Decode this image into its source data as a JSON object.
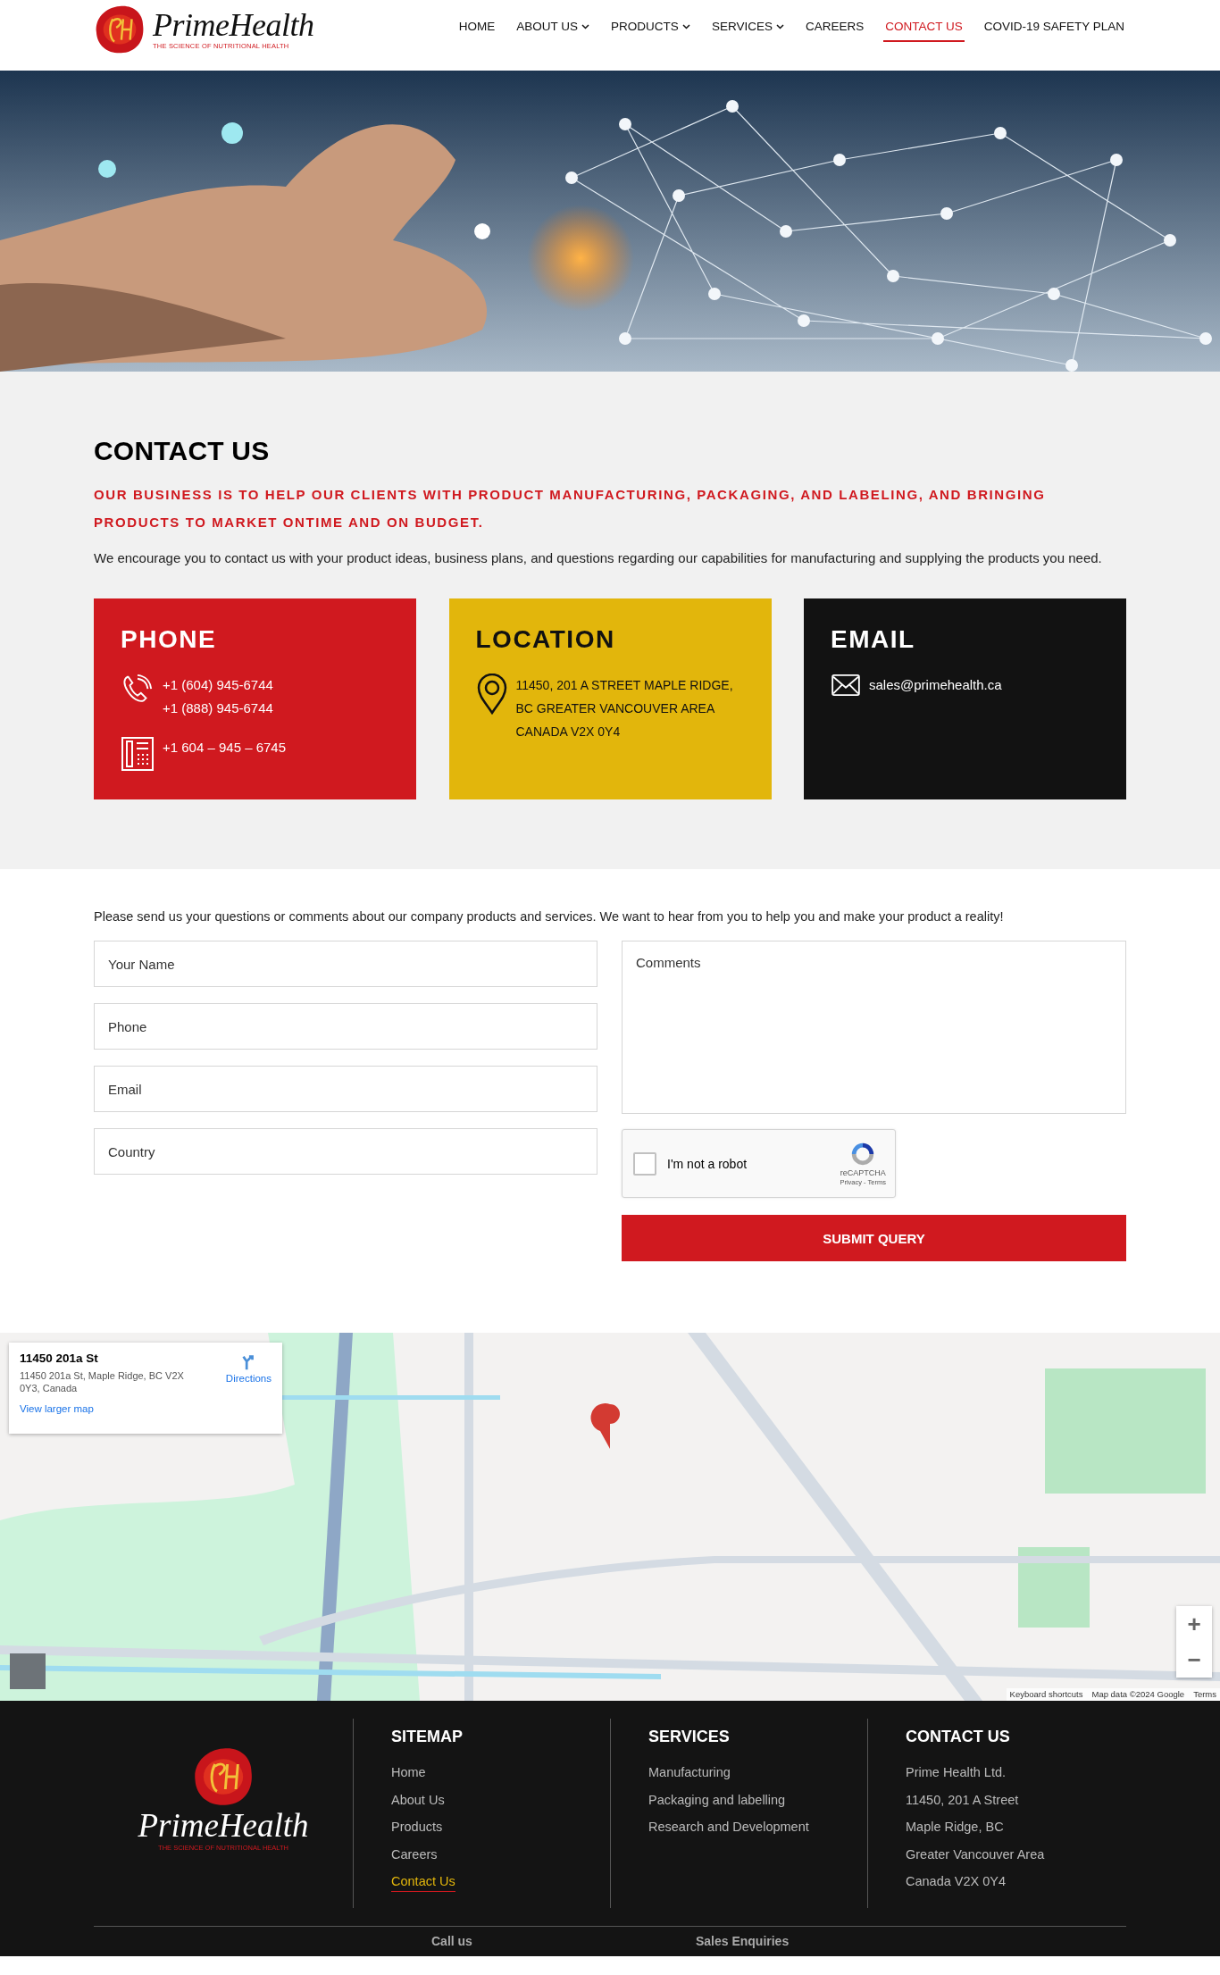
{
  "header": {
    "logo": {
      "name": "PrimeHealth",
      "tagline": "THE SCIENCE OF NUTRITIONAL HEALTH"
    },
    "nav": [
      {
        "label": "HOME",
        "dropdown": false,
        "selected": false
      },
      {
        "label": "ABOUT US",
        "dropdown": true,
        "selected": false
      },
      {
        "label": "PRODUCTS",
        "dropdown": true,
        "selected": false
      },
      {
        "label": "SERVICES",
        "dropdown": true,
        "selected": false
      },
      {
        "label": "CAREERS",
        "dropdown": false,
        "selected": false
      },
      {
        "label": "CONTACT US",
        "dropdown": false,
        "selected": true
      },
      {
        "label": "COVID-19 SAFETY PLAN",
        "dropdown": false,
        "selected": false
      }
    ]
  },
  "contact": {
    "title": "CONTACT US",
    "tagline": "OUR BUSINESS IS TO HELP OUR CLIENTS WITH PRODUCT MANUFACTURING, PACKAGING, AND LABELING, AND BRINGING PRODUCTS TO MARKET ONTIME AND ON BUDGET.",
    "intro": "We encourage you to contact us with your product ideas, business plans, and questions regarding our capabilities for manufacturing and supplying the products you need.",
    "cards": [
      {
        "kind": "phone",
        "title": "PHONE",
        "color": "#d0191f",
        "groups": [
          {
            "kind": "phone",
            "lines": [
              "+1 (604) 945-6744",
              "+1 (888) 945-6744"
            ]
          },
          {
            "kind": "fax",
            "lines": [
              "+1 604 – 945 – 6745"
            ]
          }
        ]
      },
      {
        "kind": "location",
        "title": "LOCATION",
        "color": "#e2b60c",
        "groups": [
          {
            "kind": "pin",
            "lines": [
              "11450, 201 A STREET MAPLE RIDGE,",
              "BC GREATER VANCOUVER AREA",
              "CANADA V2X 0Y4"
            ]
          }
        ]
      },
      {
        "kind": "email",
        "title": "EMAIL",
        "color": "#121212",
        "groups": [
          {
            "kind": "mail",
            "lines": [
              "sales@primehealth.ca"
            ]
          }
        ]
      }
    ]
  },
  "form": {
    "intro": "Please send us your questions or comments about our company products and services. We want to hear from you to help you and make your product a reality!",
    "fields": [
      {
        "placeholder": "Your Name"
      },
      {
        "placeholder": "Phone"
      },
      {
        "placeholder": "Email"
      },
      {
        "placeholder": "Country"
      }
    ],
    "comments": {
      "placeholder": "Comments"
    },
    "captcha": {
      "label": "I'm not a robot",
      "checked": false,
      "brand": "reCAPTCHA",
      "links": "Privacy - Terms"
    },
    "submit": "SUBMIT QUERY"
  },
  "map": {
    "kind": "picture",
    "card": {
      "title": "11450 201a St",
      "address": "11450 201a St, Maple Ridge, BC V2X 0Y3, Canada",
      "directions": "Directions",
      "link": "View larger map"
    },
    "zoom": [
      "+",
      "−"
    ],
    "attribution": [
      "Keyboard shortcuts",
      "Map data ©2024 Google",
      "Terms"
    ]
  },
  "footer": {
    "logo": {
      "name": "PrimeHealth",
      "tagline": "THE SCIENCE OF NUTRITIONAL HEALTH"
    },
    "columns": [
      {
        "title": "SITEMAP",
        "items": [
          {
            "label": "Home",
            "selected": false
          },
          {
            "label": "About Us",
            "selected": false
          },
          {
            "label": "Products",
            "selected": false
          },
          {
            "label": "Careers",
            "selected": false
          },
          {
            "label": "Contact Us",
            "selected": true
          }
        ]
      },
      {
        "title": "SERVICES",
        "items": [
          {
            "label": "Manufacturing",
            "selected": false
          },
          {
            "label": "Packaging and labelling",
            "selected": false
          },
          {
            "label": "Research and Development",
            "selected": false
          }
        ]
      },
      {
        "title": "CONTACT US",
        "items": [
          {
            "label": "Prime Health Ltd.",
            "selected": false
          },
          {
            "label": "11450, 201 A Street",
            "selected": false
          },
          {
            "label": "Maple Ridge, BC",
            "selected": false
          },
          {
            "label": "Greater Vancouver Area",
            "selected": false
          },
          {
            "label": "Canada V2X 0Y4",
            "selected": false
          }
        ]
      }
    ],
    "bottom": [
      "Call us",
      "Sales Enquiries"
    ]
  }
}
